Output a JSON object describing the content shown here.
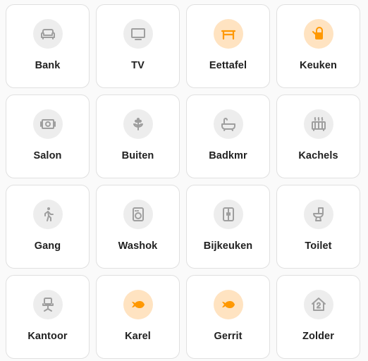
{
  "colors": {
    "active": "#ff9800",
    "active_bg": "#ffe3c1",
    "inactive": "#9e9e9e",
    "inactive_bg": "#ededed"
  },
  "tiles": [
    {
      "label": "Bank",
      "icon": "sofa-icon",
      "state": "off"
    },
    {
      "label": "TV",
      "icon": "television-icon",
      "state": "off"
    },
    {
      "label": "Eettafel",
      "icon": "table-icon",
      "state": "on"
    },
    {
      "label": "Keuken",
      "icon": "kettle-icon",
      "state": "on"
    },
    {
      "label": "Salon",
      "icon": "speaker-icon",
      "state": "off"
    },
    {
      "label": "Buiten",
      "icon": "flower-icon",
      "state": "off"
    },
    {
      "label": "Badkmr",
      "icon": "bathtub-icon",
      "state": "off"
    },
    {
      "label": "Kachels",
      "icon": "radiator-icon",
      "state": "off"
    },
    {
      "label": "Gang",
      "icon": "walk-icon",
      "state": "off"
    },
    {
      "label": "Washok",
      "icon": "washing-machine-icon",
      "state": "off"
    },
    {
      "label": "Bijkeuken",
      "icon": "fridge-icon",
      "state": "off"
    },
    {
      "label": "Toilet",
      "icon": "toilet-icon",
      "state": "off"
    },
    {
      "label": "Kantoor",
      "icon": "desk-chair-icon",
      "state": "off"
    },
    {
      "label": "Karel",
      "icon": "fish-icon",
      "state": "on"
    },
    {
      "label": "Gerrit",
      "icon": "fish-icon",
      "state": "on"
    },
    {
      "label": "Zolder",
      "icon": "home-floor-2-icon",
      "state": "off"
    }
  ]
}
